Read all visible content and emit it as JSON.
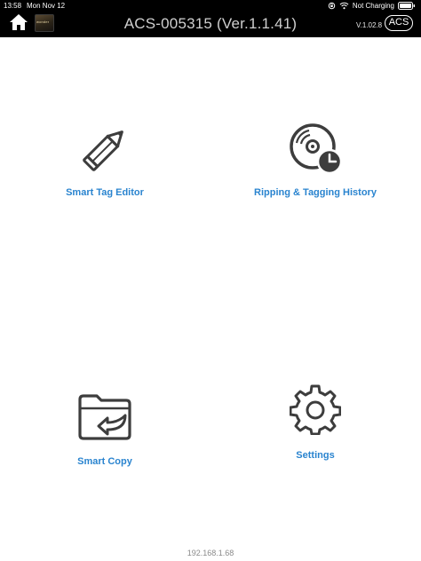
{
  "status_bar": {
    "time": "13:58",
    "date": "Mon Nov 12",
    "charging": "Not Charging"
  },
  "header": {
    "title": "ACS-005315 (Ver.1.1.41)",
    "version": "V.1.02.8",
    "acs_button": "ACS",
    "thumbnail_text": "wonder"
  },
  "menu": {
    "smart_tag_editor": "Smart Tag Editor",
    "ripping_history": "Ripping & Tagging History",
    "smart_copy": "Smart Copy",
    "settings": "Settings"
  },
  "footer": {
    "ip": "192.168.1.68"
  },
  "colors": {
    "label_blue": "#2a84cf",
    "icon_dark": "#3d3d3d",
    "bar_black": "#000000"
  },
  "icons": {
    "home": "home-icon",
    "editor": "pencil-icon",
    "history": "disc-clock-icon",
    "copy": "folder-arrow-icon",
    "settings": "gear-icon",
    "wifi": "wifi-icon",
    "battery": "battery-icon",
    "orientation": "orientation-lock-icon"
  }
}
